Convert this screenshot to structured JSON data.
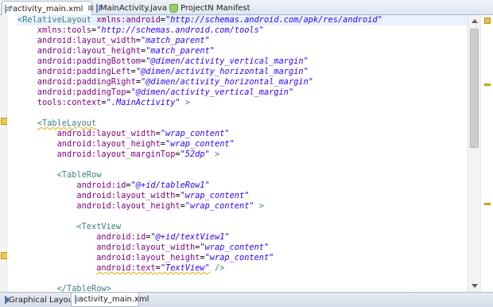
{
  "tabs": [
    {
      "label": "*activity_main.xml",
      "icon": "xml-file-icon",
      "active": true,
      "close": "⊠"
    },
    {
      "label": "MainActivity.java",
      "icon": "java-file-icon",
      "active": false
    },
    {
      "label": "ProjectN Manifest",
      "icon": "android-manifest-icon",
      "active": false
    }
  ],
  "code_lines": [
    [
      {
        "t": "tag",
        "v": "<RelativeLayout"
      },
      {
        "t": "punct",
        "v": " "
      },
      {
        "t": "attr",
        "v": "xmlns:android"
      },
      {
        "t": "punct",
        "v": "="
      },
      {
        "t": "val",
        "v": "\"http://schemas.android.com/apk/res/android\""
      }
    ],
    [
      {
        "t": "punct",
        "v": "    "
      },
      {
        "t": "attr",
        "v": "xmlns:tools"
      },
      {
        "t": "punct",
        "v": "="
      },
      {
        "t": "val",
        "v": "\"http://schemas.android.com/tools\""
      }
    ],
    [
      {
        "t": "punct",
        "v": "    "
      },
      {
        "t": "attr",
        "v": "android:layout_width"
      },
      {
        "t": "punct",
        "v": "="
      },
      {
        "t": "val",
        "v": "\"match_parent\""
      }
    ],
    [
      {
        "t": "punct",
        "v": "    "
      },
      {
        "t": "attr",
        "v": "android:layout_height"
      },
      {
        "t": "punct",
        "v": "="
      },
      {
        "t": "val",
        "v": "\"match_parent\""
      }
    ],
    [
      {
        "t": "punct",
        "v": "    "
      },
      {
        "t": "attr",
        "v": "android:paddingBottom"
      },
      {
        "t": "punct",
        "v": "="
      },
      {
        "t": "val",
        "v": "\"@dimen/activity_vertical_margin\""
      }
    ],
    [
      {
        "t": "punct",
        "v": "    "
      },
      {
        "t": "attr",
        "v": "android:paddingLeft"
      },
      {
        "t": "punct",
        "v": "="
      },
      {
        "t": "val",
        "v": "\"@dimen/activity_horizontal_margin\""
      }
    ],
    [
      {
        "t": "punct",
        "v": "    "
      },
      {
        "t": "attr",
        "v": "android:paddingRight"
      },
      {
        "t": "punct",
        "v": "="
      },
      {
        "t": "val",
        "v": "\"@dimen/activity_horizontal_margin\""
      }
    ],
    [
      {
        "t": "punct",
        "v": "    "
      },
      {
        "t": "attr",
        "v": "android:paddingTop"
      },
      {
        "t": "punct",
        "v": "="
      },
      {
        "t": "val",
        "v": "\"@dimen/activity_vertical_margin\""
      }
    ],
    [
      {
        "t": "punct",
        "v": "    "
      },
      {
        "t": "attr",
        "v": "tools:context"
      },
      {
        "t": "punct",
        "v": "="
      },
      {
        "t": "val",
        "v": "\".MainActivity\""
      },
      {
        "t": "punct",
        "v": " "
      },
      {
        "t": "tag",
        "v": ">"
      }
    ],
    [],
    [
      {
        "t": "punct",
        "v": "    "
      },
      {
        "t": "tag",
        "v": "<TableLayout",
        "warn": true
      }
    ],
    [
      {
        "t": "punct",
        "v": "        "
      },
      {
        "t": "attr",
        "v": "android:layout_width"
      },
      {
        "t": "punct",
        "v": "="
      },
      {
        "t": "val",
        "v": "\"wrap_content\""
      }
    ],
    [
      {
        "t": "punct",
        "v": "        "
      },
      {
        "t": "attr",
        "v": "android:layout_height"
      },
      {
        "t": "punct",
        "v": "="
      },
      {
        "t": "val",
        "v": "\"wrap_content\""
      }
    ],
    [
      {
        "t": "punct",
        "v": "        "
      },
      {
        "t": "attr",
        "v": "android:layout_marginTop"
      },
      {
        "t": "punct",
        "v": "="
      },
      {
        "t": "val",
        "v": "\"52dp\""
      },
      {
        "t": "punct",
        "v": " "
      },
      {
        "t": "tag",
        "v": ">"
      }
    ],
    [],
    [
      {
        "t": "punct",
        "v": "        "
      },
      {
        "t": "tag",
        "v": "<TableRow"
      }
    ],
    [
      {
        "t": "punct",
        "v": "            "
      },
      {
        "t": "attr",
        "v": "android:id"
      },
      {
        "t": "punct",
        "v": "="
      },
      {
        "t": "val",
        "v": "\"@+id/tableRow1\""
      }
    ],
    [
      {
        "t": "punct",
        "v": "            "
      },
      {
        "t": "attr",
        "v": "android:layout_width"
      },
      {
        "t": "punct",
        "v": "="
      },
      {
        "t": "val",
        "v": "\"wrap_content\""
      }
    ],
    [
      {
        "t": "punct",
        "v": "            "
      },
      {
        "t": "attr",
        "v": "android:layout_height"
      },
      {
        "t": "punct",
        "v": "="
      },
      {
        "t": "val",
        "v": "\"wrap_content\""
      },
      {
        "t": "punct",
        "v": " "
      },
      {
        "t": "tag",
        "v": ">"
      }
    ],
    [],
    [
      {
        "t": "punct",
        "v": "            "
      },
      {
        "t": "tag",
        "v": "<TextView"
      }
    ],
    [
      {
        "t": "punct",
        "v": "                "
      },
      {
        "t": "attr",
        "v": "android:id"
      },
      {
        "t": "punct",
        "v": "="
      },
      {
        "t": "val",
        "v": "\"@+id/textView1\""
      }
    ],
    [
      {
        "t": "punct",
        "v": "                "
      },
      {
        "t": "attr",
        "v": "android:layout_width"
      },
      {
        "t": "punct",
        "v": "="
      },
      {
        "t": "val",
        "v": "\"wrap_content\""
      }
    ],
    [
      {
        "t": "punct",
        "v": "                "
      },
      {
        "t": "attr",
        "v": "android:layout_height"
      },
      {
        "t": "punct",
        "v": "="
      },
      {
        "t": "val",
        "v": "\"wrap_content\""
      }
    ],
    [
      {
        "t": "punct",
        "v": "                "
      },
      {
        "t": "attr",
        "v": "android:text",
        "warn": true
      },
      {
        "t": "punct",
        "v": "=",
        "warn": true
      },
      {
        "t": "val",
        "v": "\"TextView\"",
        "warn": true
      },
      {
        "t": "punct",
        "v": " "
      },
      {
        "t": "tag",
        "v": "/>"
      }
    ],
    [],
    [
      {
        "t": "punct",
        "v": "        "
      },
      {
        "t": "tag",
        "v": "</TableRow>"
      }
    ]
  ],
  "bottom_tabs": [
    {
      "label": "Graphical Layout",
      "icon": "graphical-layout-icon",
      "active": false
    },
    {
      "label": "activity_main.xml",
      "icon": "xml-file-icon",
      "active": true
    }
  ],
  "colors": {
    "tag": "#3f7f7f",
    "attribute": "#7f007f",
    "value": "#2a00ff",
    "current_line": "#e8f2fe",
    "warning": "#f2c84b"
  }
}
